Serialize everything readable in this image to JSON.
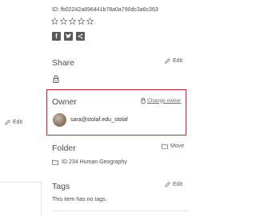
{
  "item": {
    "id_text": "ID: fb02242a896441b78a0a790dc3a6c363",
    "rating_stars": 5,
    "rating_value": 0,
    "social": [
      {
        "name": "facebook",
        "glyph": "f"
      },
      {
        "name": "twitter",
        "glyph": "t"
      },
      {
        "name": "share",
        "glyph": "<"
      }
    ]
  },
  "left_panel": {
    "edit_label": "Edit"
  },
  "share": {
    "heading": "Share",
    "edit_label": "Edit",
    "status_icon": "lock-icon"
  },
  "owner": {
    "heading": "Owner",
    "change_owner_label": "Change owner",
    "username": "sara@stolaf.edu_stolaf",
    "highlight_color": "#d9202a"
  },
  "folder": {
    "heading": "Folder",
    "move_label": "Move",
    "name": "ID 234 Human Geography"
  },
  "tags": {
    "heading": "Tags",
    "edit_label": "Edit",
    "empty_text": "This item has no tags."
  }
}
